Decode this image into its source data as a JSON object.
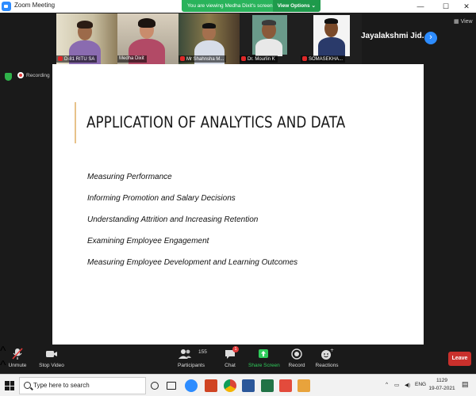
{
  "window": {
    "title": "Zoom Meeting",
    "controls": {
      "minimize": "—",
      "maximize": "☐",
      "close": "✕"
    }
  },
  "banner": {
    "text": "You are viewing Medha Dixit's screen",
    "options_label": "View Options ⌄"
  },
  "participants_strip": [
    {
      "name": "D-81 RITU SA",
      "muted": true
    },
    {
      "name": "Medha Dixit",
      "muted": false,
      "active": true
    },
    {
      "name": "Mr Shahnsha M...",
      "muted": true
    },
    {
      "name": "Dr. Mourlin K",
      "muted": true
    },
    {
      "name": "SOMASEKHA...",
      "muted": true
    },
    {
      "name": "",
      "muted": true
    }
  ],
  "featured_name": "Jayalakshmi  Jid...",
  "view_label": "View",
  "recording_label": "Recording",
  "slide": {
    "title": "APPLICATION OF ANALYTICS AND DATA",
    "bullets": [
      "Measuring Performance",
      "Informing Promotion and Salary Decisions",
      "Understanding Attrition and Increasing Retention",
      "Examining Employee Engagement",
      "Measuring Employee Development and Learning Outcomes"
    ]
  },
  "toolbar": {
    "unmute": "Unmute",
    "stop_video": "Stop Video",
    "participants": "Participants",
    "participants_count": "155",
    "chat": "Chat",
    "chat_badge": "1",
    "share_screen": "Share Screen",
    "record": "Record",
    "reactions": "Reactions",
    "leave": "Leave"
  },
  "taskbar": {
    "search_placeholder": "Type here to search",
    "language": "ENG",
    "time": "1129",
    "date": "19-07-2021"
  },
  "colors": {
    "zoom_blue": "#2d8cff",
    "banner_green": "#29b35b",
    "leave_red": "#c9302c",
    "share_green": "#2fcc5b",
    "slide_accent": "#e7c28a"
  }
}
